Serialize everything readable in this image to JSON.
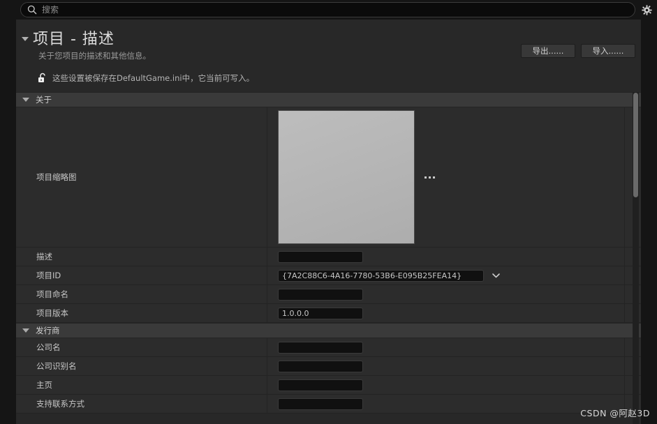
{
  "topbar": {
    "search_placeholder": "搜索",
    "search_value": "",
    "search_icon": "search-icon",
    "settings_icon": "gear-icon"
  },
  "header": {
    "title": "项目 - 描述",
    "subtitle": "关于您项目的描述和其他信息。",
    "lock_icon": "unlocked-padlock-icon",
    "lock_text": "这些设置被保存在DefaultGame.ini中，它当前可写入。",
    "export_label": "导出......",
    "import_label": "导入......"
  },
  "sections": [
    {
      "label": "关于",
      "rows": [
        {
          "label": "项目缩略图",
          "type": "thumbnail",
          "value": "",
          "more_label": "..."
        },
        {
          "label": "描述",
          "type": "text",
          "value": ""
        },
        {
          "label": "项目ID",
          "type": "combo",
          "value": "{7A2C88C6-4A16-7780-53B6-E095B25FEA14}"
        },
        {
          "label": "项目命名",
          "type": "text",
          "value": ""
        },
        {
          "label": "项目版本",
          "type": "text",
          "value": "1.0.0.0"
        }
      ]
    },
    {
      "label": "发行商",
      "rows": [
        {
          "label": "公司名",
          "type": "text",
          "value": ""
        },
        {
          "label": "公司识别名",
          "type": "text",
          "value": ""
        },
        {
          "label": "主页",
          "type": "text",
          "value": ""
        },
        {
          "label": "支持联系方式",
          "type": "text",
          "value": ""
        }
      ]
    }
  ],
  "watermark": "CSDN @阿赵3D",
  "colors": {
    "panel_bg": "#282828",
    "row_bg": "#2c2c2c",
    "section_bg": "#3a3a3a",
    "field_bg": "#101010",
    "text": "#c6c6c6",
    "scrollbar": "#6a6a6a"
  }
}
